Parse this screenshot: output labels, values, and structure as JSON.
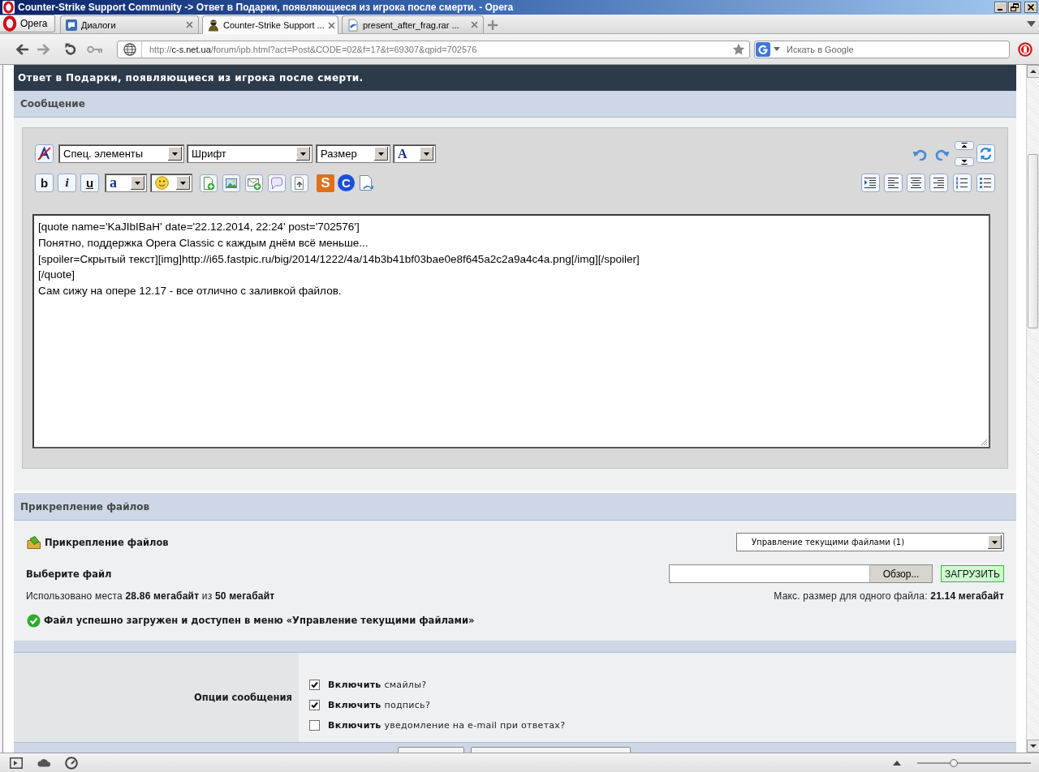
{
  "window": {
    "title": "Counter-Strike Support Community -> Ответ в Подарки, появляющиеся из игрока после смерти. - Opera"
  },
  "tab_bar": {
    "menu_button": "Opera",
    "tabs": [
      {
        "label": "Диалоги",
        "kind": "chat",
        "selected": false
      },
      {
        "label": "Counter-Strike Support ...",
        "kind": "figure",
        "selected": true
      },
      {
        "label": "present_after_frag.rar ...",
        "kind": "file",
        "selected": false
      }
    ]
  },
  "address_bar": {
    "scheme": "http://",
    "host": "c-s.net.ua",
    "path": "/forum/ipb.html?act=Post&CODE=02&f=17&t=69307&qpid=702576"
  },
  "search": {
    "placeholder": "Искать в Google"
  },
  "page_title": "Ответ в Подарки, появляющиеся из игрока после смерти.",
  "message": {
    "title": "Сообщение",
    "dropdowns": [
      "Спец. элементы",
      "Шрифт",
      "Размер"
    ],
    "font_color": "A",
    "format_buttons": [
      {
        "label": "b",
        "kind": "bold"
      },
      {
        "label": "i",
        "kind": "italic"
      },
      {
        "label": "u",
        "kind": "underline"
      }
    ],
    "highlight": "a",
    "letter_buttons": [
      {
        "label": "S",
        "kind": "square",
        "color": "#e0701c"
      },
      {
        "label": "C",
        "kind": "circle",
        "color": "#1a4fd8"
      }
    ],
    "text": [
      "[quote name='KaJIbIBaH' date='22.12.2014, 22:24' post='702576']",
      "Понятно, поддержка Opera Classic с каждым днём всё меньше...",
      "[spoiler=Скрытый текст][img]http://i65.fastpic.ru/big/2014/1222/4a/14b3b41bf03bae0e8f645a2c2a9a4c4a.png[/img][/spoiler]",
      "[/quote]",
      "Сам сижу на опере 12.17 - все отлично с заливкой файлов."
    ]
  },
  "attachments": {
    "title": "Прикрепление файлов",
    "label": "Прикрепление файлов",
    "manage_dropdown": "Управление текущими файлами (1)",
    "choose_label": "Выберите файл",
    "browse_button": "Обзор...",
    "upload_button": "ЗАГРУЗИТЬ",
    "usage": "Использовано места **28.86 мегабайт** из **50 мегабайт**",
    "max_size": "Макс. размер для одного файла: **21.14 мегабайт**",
    "success": "Файл успешно загружен и доступен в меню «Управление текущими файлами»"
  },
  "options": {
    "label": "Опции сообщения",
    "items": [
      {
        "label": "**Включить** смайлы?",
        "checked": true
      },
      {
        "label": "**Включить** подпись?",
        "checked": true
      },
      {
        "label": "**Включить** уведомление на e-mail при ответах?",
        "checked": false
      }
    ]
  },
  "status_bar": {
    "zoom": {
      "level": 0.32
    }
  }
}
